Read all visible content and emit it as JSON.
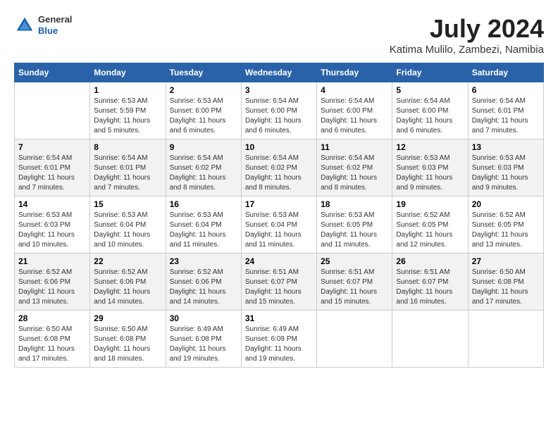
{
  "header": {
    "logo": {
      "general": "General",
      "blue": "Blue"
    },
    "title": "July 2024",
    "location": "Katima Mulilo, Zambezi, Namibia"
  },
  "days_of_week": [
    "Sunday",
    "Monday",
    "Tuesday",
    "Wednesday",
    "Thursday",
    "Friday",
    "Saturday"
  ],
  "weeks": [
    [
      {
        "day": "",
        "info": ""
      },
      {
        "day": "1",
        "info": "Sunrise: 6:53 AM\nSunset: 5:59 PM\nDaylight: 11 hours\nand 5 minutes."
      },
      {
        "day": "2",
        "info": "Sunrise: 6:53 AM\nSunset: 6:00 PM\nDaylight: 11 hours\nand 6 minutes."
      },
      {
        "day": "3",
        "info": "Sunrise: 6:54 AM\nSunset: 6:00 PM\nDaylight: 11 hours\nand 6 minutes."
      },
      {
        "day": "4",
        "info": "Sunrise: 6:54 AM\nSunset: 6:00 PM\nDaylight: 11 hours\nand 6 minutes."
      },
      {
        "day": "5",
        "info": "Sunrise: 6:54 AM\nSunset: 6:00 PM\nDaylight: 11 hours\nand 6 minutes."
      },
      {
        "day": "6",
        "info": "Sunrise: 6:54 AM\nSunset: 6:01 PM\nDaylight: 11 hours\nand 7 minutes."
      }
    ],
    [
      {
        "day": "7",
        "info": "Sunrise: 6:54 AM\nSunset: 6:01 PM\nDaylight: 11 hours\nand 7 minutes."
      },
      {
        "day": "8",
        "info": "Sunrise: 6:54 AM\nSunset: 6:01 PM\nDaylight: 11 hours\nand 7 minutes."
      },
      {
        "day": "9",
        "info": "Sunrise: 6:54 AM\nSunset: 6:02 PM\nDaylight: 11 hours\nand 8 minutes."
      },
      {
        "day": "10",
        "info": "Sunrise: 6:54 AM\nSunset: 6:02 PM\nDaylight: 11 hours\nand 8 minutes."
      },
      {
        "day": "11",
        "info": "Sunrise: 6:54 AM\nSunset: 6:02 PM\nDaylight: 11 hours\nand 8 minutes."
      },
      {
        "day": "12",
        "info": "Sunrise: 6:53 AM\nSunset: 6:03 PM\nDaylight: 11 hours\nand 9 minutes."
      },
      {
        "day": "13",
        "info": "Sunrise: 6:53 AM\nSunset: 6:03 PM\nDaylight: 11 hours\nand 9 minutes."
      }
    ],
    [
      {
        "day": "14",
        "info": "Sunrise: 6:53 AM\nSunset: 6:03 PM\nDaylight: 11 hours\nand 10 minutes."
      },
      {
        "day": "15",
        "info": "Sunrise: 6:53 AM\nSunset: 6:04 PM\nDaylight: 11 hours\nand 10 minutes."
      },
      {
        "day": "16",
        "info": "Sunrise: 6:53 AM\nSunset: 6:04 PM\nDaylight: 11 hours\nand 11 minutes."
      },
      {
        "day": "17",
        "info": "Sunrise: 6:53 AM\nSunset: 6:04 PM\nDaylight: 11 hours\nand 11 minutes."
      },
      {
        "day": "18",
        "info": "Sunrise: 6:53 AM\nSunset: 6:05 PM\nDaylight: 11 hours\nand 11 minutes."
      },
      {
        "day": "19",
        "info": "Sunrise: 6:52 AM\nSunset: 6:05 PM\nDaylight: 11 hours\nand 12 minutes."
      },
      {
        "day": "20",
        "info": "Sunrise: 6:52 AM\nSunset: 6:05 PM\nDaylight: 11 hours\nand 13 minutes."
      }
    ],
    [
      {
        "day": "21",
        "info": "Sunrise: 6:52 AM\nSunset: 6:06 PM\nDaylight: 11 hours\nand 13 minutes."
      },
      {
        "day": "22",
        "info": "Sunrise: 6:52 AM\nSunset: 6:06 PM\nDaylight: 11 hours\nand 14 minutes."
      },
      {
        "day": "23",
        "info": "Sunrise: 6:52 AM\nSunset: 6:06 PM\nDaylight: 11 hours\nand 14 minutes."
      },
      {
        "day": "24",
        "info": "Sunrise: 6:51 AM\nSunset: 6:07 PM\nDaylight: 11 hours\nand 15 minutes."
      },
      {
        "day": "25",
        "info": "Sunrise: 6:51 AM\nSunset: 6:07 PM\nDaylight: 11 hours\nand 15 minutes."
      },
      {
        "day": "26",
        "info": "Sunrise: 6:51 AM\nSunset: 6:07 PM\nDaylight: 11 hours\nand 16 minutes."
      },
      {
        "day": "27",
        "info": "Sunrise: 6:50 AM\nSunset: 6:08 PM\nDaylight: 11 hours\nand 17 minutes."
      }
    ],
    [
      {
        "day": "28",
        "info": "Sunrise: 6:50 AM\nSunset: 6:08 PM\nDaylight: 11 hours\nand 17 minutes."
      },
      {
        "day": "29",
        "info": "Sunrise: 6:50 AM\nSunset: 6:08 PM\nDaylight: 11 hours\nand 18 minutes."
      },
      {
        "day": "30",
        "info": "Sunrise: 6:49 AM\nSunset: 6:08 PM\nDaylight: 11 hours\nand 19 minutes."
      },
      {
        "day": "31",
        "info": "Sunrise: 6:49 AM\nSunset: 6:09 PM\nDaylight: 11 hours\nand 19 minutes."
      },
      {
        "day": "",
        "info": ""
      },
      {
        "day": "",
        "info": ""
      },
      {
        "day": "",
        "info": ""
      }
    ]
  ]
}
